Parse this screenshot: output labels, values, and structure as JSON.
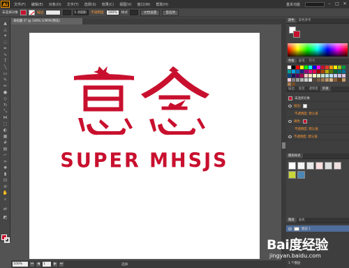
{
  "menubar": {
    "logo": "Ai",
    "items": [
      "文件(F)",
      "编辑(E)",
      "对象(O)",
      "文字(T)",
      "选择(S)",
      "效果(C)",
      "视图(V)",
      "窗口(W)",
      "帮助(H)"
    ],
    "workspace": "基本功能"
  },
  "controlbar": {
    "selection": "未选择对象",
    "stroke_label": "描边",
    "stroke_value": "",
    "brush": "5 点圆形",
    "opacity_label": "不透明度",
    "opacity_value": "100%",
    "style_label": "样式",
    "doc_setup": "文档设置",
    "preferences": "首选项"
  },
  "document": {
    "tab_title": "未标题-1* @ 100% (CMYK/预览)"
  },
  "artwork": {
    "chinese_text": "意念",
    "english_text": "SUPER MHSJS",
    "color": "#c8102e"
  },
  "statusbar": {
    "zoom": "100%",
    "page": "1",
    "tool": "选择"
  },
  "panels": {
    "color_tabs": [
      "颜色",
      "颜色参考"
    ],
    "swatch_tabs": [
      "色板",
      "画笔",
      "符号"
    ],
    "appearance_tabs": [
      "描边",
      "渐变",
      "透明度",
      "外观"
    ],
    "appearance": {
      "title": "未选择对象",
      "stroke_label": "描边:",
      "stroke_opacity": "不透明度: 默认值",
      "fill_label": "填色:",
      "fill_opacity": "不透明度: 默认值",
      "opacity": "不透明度: 默认值"
    },
    "graphic_styles_tab": "图形样式",
    "layers_tabs": [
      "图层",
      "画板"
    ],
    "layer_name": "图层 1",
    "layers_footer": "1 个图层"
  },
  "watermark": {
    "brand": "Bai度经验",
    "url": "jingyan.baidu.com"
  },
  "swatch_colors": [
    "#ffffff",
    "#000000",
    "#ff0000",
    "#ffff00",
    "#00ff00",
    "#00ffff",
    "#0000ff",
    "#ff00ff",
    "#c8102e",
    "#e8392a",
    "#f39800",
    "#fff100",
    "#8fc31f",
    "#009944",
    "#009e96",
    "#00a0e9",
    "#0068b7",
    "#1d2088",
    "#920783",
    "#e4007f",
    "#e5004f",
    "#a40000",
    "#a84200",
    "#b7aa00",
    "#5a7b00",
    "#006934",
    "#006e6a",
    "#006f9a",
    "#004986",
    "#1a1464",
    "#5e0063",
    "#a4004d",
    "#f8c6c7",
    "#fce3c4",
    "#fffbc7",
    "#dbeac3",
    "#c2dfc9",
    "#bde3e3",
    "#bce2f8",
    "#c3d0ec",
    "#c7c1e0",
    "#dcc4de",
    "#f3c9dc",
    "#7f7f7f",
    "#999999",
    "#b2b2b2",
    "#cccccc",
    "#e5e5e5",
    "#594a3c",
    "#7b6046",
    "#9c7a54",
    "#bd9a6e",
    "#d6b98c",
    "#8c6239",
    "#603913",
    "#c69c6d",
    "#a67c52",
    "#754c24"
  ]
}
